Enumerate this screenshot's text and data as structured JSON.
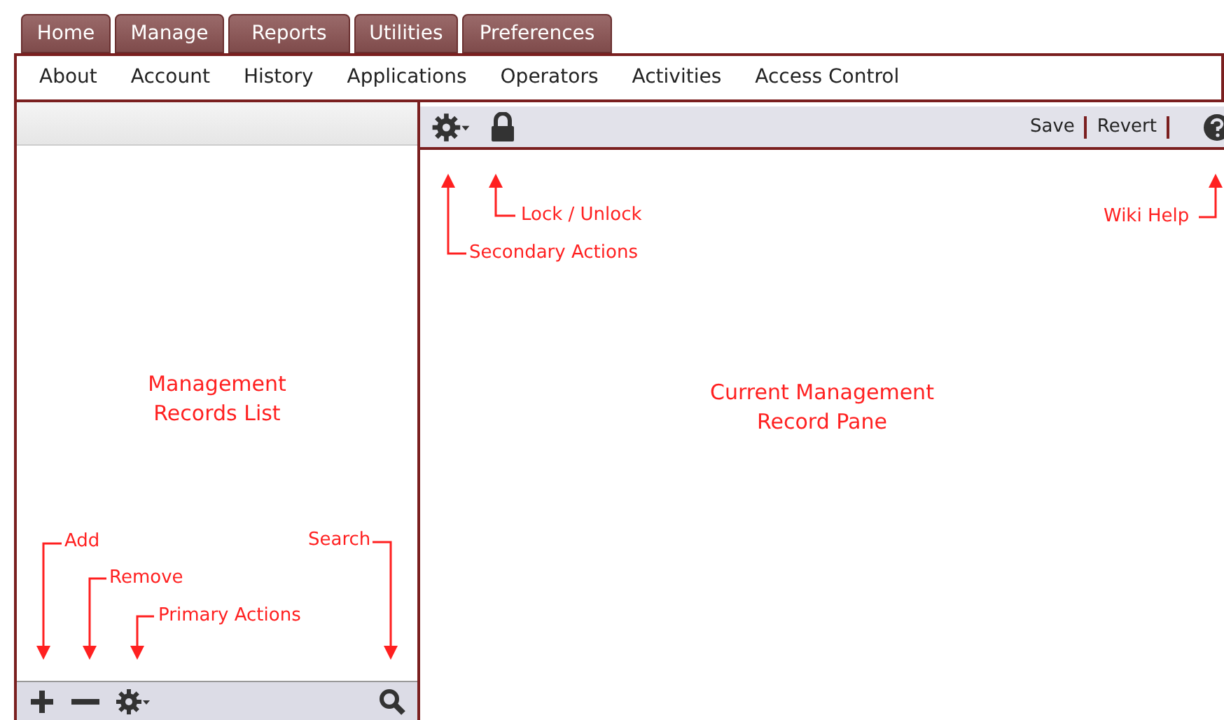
{
  "tabs": [
    {
      "label": "Home"
    },
    {
      "label": "Manage"
    },
    {
      "label": "Reports"
    },
    {
      "label": "Utilities"
    },
    {
      "label": "Preferences"
    }
  ],
  "submenu": [
    "About",
    "Account",
    "History",
    "Applications",
    "Operators",
    "Activities",
    "Access Control"
  ],
  "record_toolbar": {
    "links": [
      "Save",
      "Revert"
    ]
  },
  "list_label": "Management\nRecords List",
  "pane_label": "Current Management\nRecord Pane",
  "annotations": [
    {
      "text": "Lock / Unlock"
    },
    {
      "text": "Wiki Help"
    },
    {
      "text": "Secondary Actions"
    },
    {
      "text": "Search"
    },
    {
      "text": "Add"
    },
    {
      "text": "Remove"
    },
    {
      "text": "Primary Actions"
    }
  ]
}
